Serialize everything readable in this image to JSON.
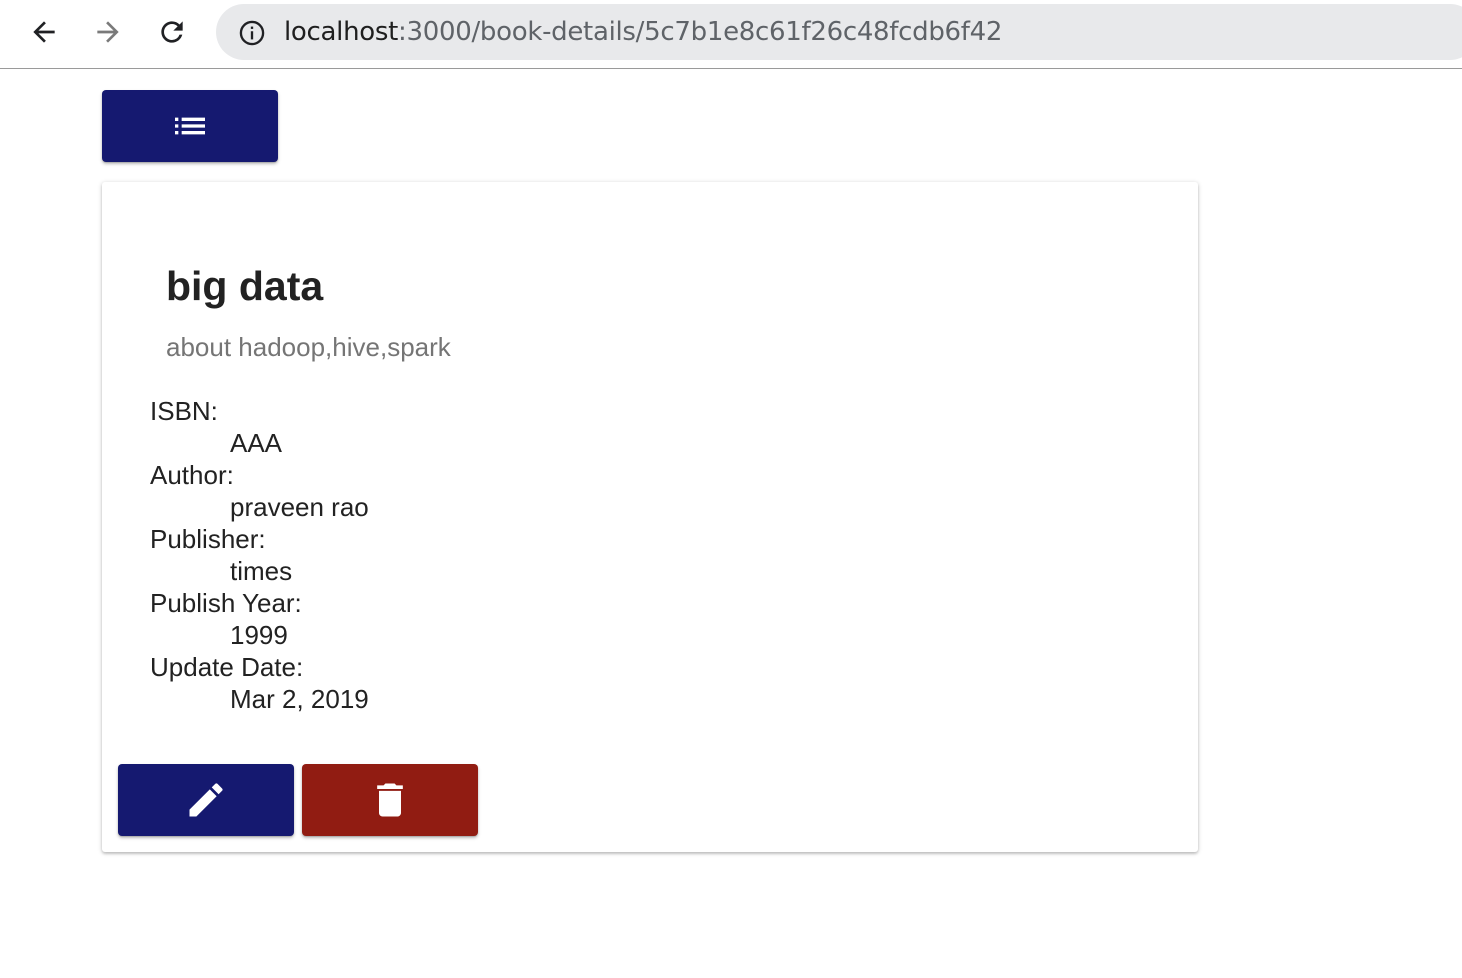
{
  "browser": {
    "url_host": "localhost",
    "url_path": ":3000/book-details/5c7b1e8c61f26c48fcdb6f42",
    "icons": {
      "back": "arrow-left-icon",
      "forward": "arrow-right-icon",
      "reload": "reload-icon",
      "site_info": "info-circle-icon"
    }
  },
  "toolbar": {
    "list_button_icon": "list-icon"
  },
  "book": {
    "title": "big data",
    "description": "about hadoop,hive,spark",
    "details": [
      {
        "label": "ISBN:",
        "value": "AAA"
      },
      {
        "label": "Author:",
        "value": "praveen rao"
      },
      {
        "label": "Publisher:",
        "value": "times"
      },
      {
        "label": "Publish Year:",
        "value": "1999"
      },
      {
        "label": "Update Date:",
        "value": "Mar 2, 2019"
      }
    ]
  },
  "actions": {
    "edit_icon": "pencil-icon",
    "delete_icon": "trash-icon"
  },
  "colors": {
    "primary": "#151970",
    "danger": "#911c12",
    "subtitle": "#757575",
    "text": "#222222"
  }
}
